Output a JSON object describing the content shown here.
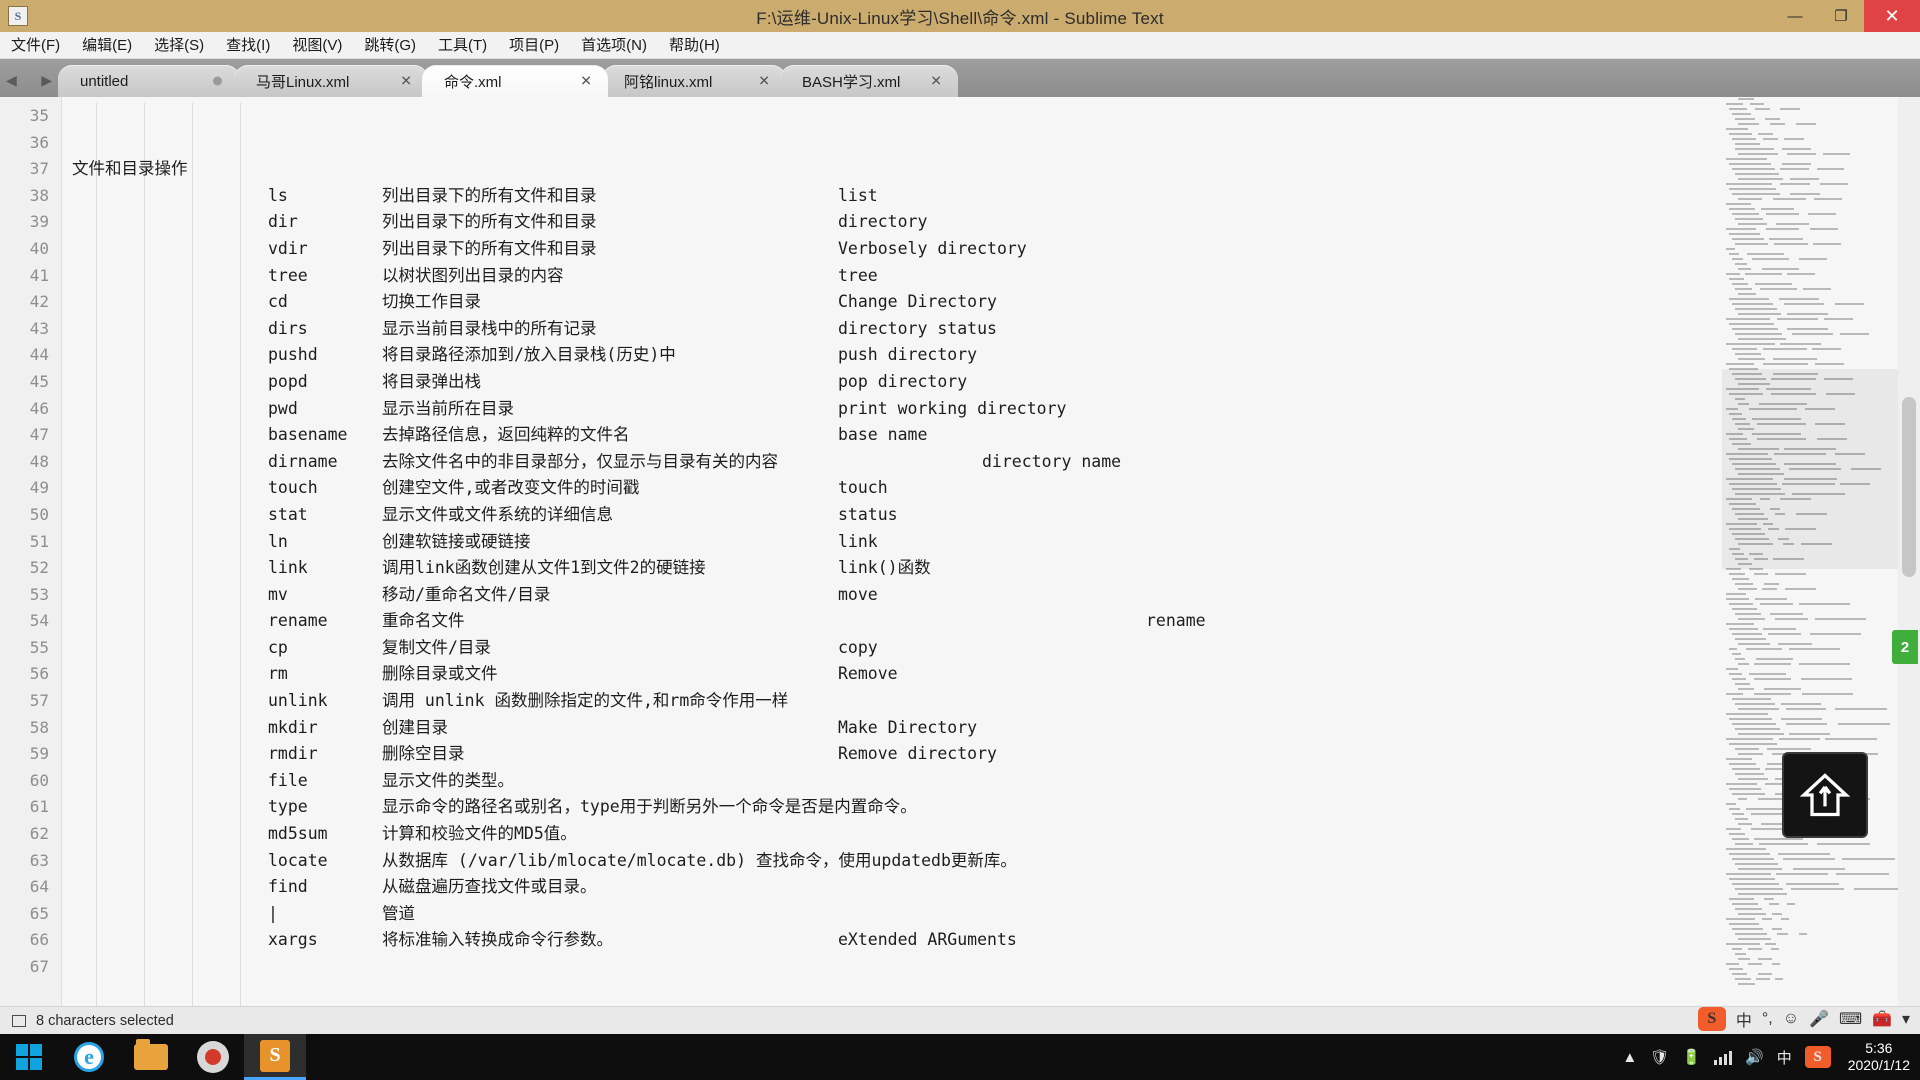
{
  "window": {
    "title": "F:\\运维-Unix-Linux学习\\Shell\\命令.xml - Sublime Text",
    "app_icon": "sublime-icon",
    "minimize": "—",
    "maximize": "❐",
    "close": "✕"
  },
  "menubar": {
    "items": [
      {
        "label": "文件(F)"
      },
      {
        "label": "编辑(E)"
      },
      {
        "label": "选择(S)"
      },
      {
        "label": "查找(I)"
      },
      {
        "label": "视图(V)"
      },
      {
        "label": "跳转(G)"
      },
      {
        "label": "工具(T)"
      },
      {
        "label": "项目(P)"
      },
      {
        "label": "首选项(N)"
      },
      {
        "label": "帮助(H)"
      }
    ]
  },
  "tabbar": {
    "prev_arrow": "◀",
    "next_arrow": "▶",
    "tabs": [
      {
        "label": "untitled",
        "active": false,
        "dirty": true,
        "close": ""
      },
      {
        "label": "马哥Linux.xml",
        "active": false,
        "dirty": false,
        "close": "✕"
      },
      {
        "label": "命令.xml",
        "active": true,
        "dirty": false,
        "close": "✕"
      },
      {
        "label": "阿铭linux.xml",
        "active": false,
        "dirty": false,
        "close": "✕"
      },
      {
        "label": "BASH学习.xml",
        "active": false,
        "dirty": false,
        "close": "✕"
      }
    ]
  },
  "editor": {
    "first_line_number": 35,
    "lines": [
      {
        "n": "35",
        "cmd": "",
        "desc": "",
        "en": "",
        "heading": ""
      },
      {
        "n": "36",
        "cmd": "",
        "desc": "",
        "en": "",
        "heading": ""
      },
      {
        "n": "37",
        "cmd": "",
        "desc": "",
        "en": "",
        "heading": "文件和目录操作"
      },
      {
        "n": "38",
        "cmd": "ls",
        "desc": "列出目录下的所有文件和目录",
        "en": "list",
        "heading": ""
      },
      {
        "n": "39",
        "cmd": "dir",
        "desc": "列出目录下的所有文件和目录",
        "en": "directory",
        "heading": ""
      },
      {
        "n": "40",
        "cmd": "vdir",
        "desc": "列出目录下的所有文件和目录",
        "en": "Verbosely directory",
        "heading": ""
      },
      {
        "n": "41",
        "cmd": "tree",
        "desc": "以树状图列出目录的内容",
        "en": "tree",
        "heading": ""
      },
      {
        "n": "42",
        "cmd": "cd",
        "desc": "切换工作目录",
        "en": "Change Directory",
        "heading": ""
      },
      {
        "n": "43",
        "cmd": "dirs",
        "desc": "显示当前目录栈中的所有记录",
        "en": "directory status",
        "heading": ""
      },
      {
        "n": "44",
        "cmd": "pushd",
        "desc": "将目录路径添加到/放入目录栈(历史)中",
        "en": "push directory",
        "heading": ""
      },
      {
        "n": "45",
        "cmd": "popd",
        "desc": "将目录弹出栈",
        "en": "pop directory",
        "heading": ""
      },
      {
        "n": "46",
        "cmd": "pwd",
        "desc": "显示当前所在目录",
        "en": "print working directory",
        "heading": ""
      },
      {
        "n": "47",
        "cmd": "basename",
        "desc": "去掉路径信息，返回纯粹的文件名",
        "en": "base name",
        "heading": ""
      },
      {
        "n": "48",
        "cmd": "dirname",
        "desc": "去除文件名中的非目录部分，仅显示与目录有关的内容",
        "en": "directory name",
        "heading": "",
        "wide": true
      },
      {
        "n": "49",
        "cmd": "touch",
        "desc": "创建空文件,或者改变文件的时间戳",
        "en": "touch",
        "heading": ""
      },
      {
        "n": "50",
        "cmd": "stat",
        "desc": "显示文件或文件系统的详细信息",
        "en": "status",
        "heading": ""
      },
      {
        "n": "51",
        "cmd": "ln",
        "desc": "创建软链接或硬链接",
        "en": "link",
        "heading": ""
      },
      {
        "n": "52",
        "cmd": "link",
        "desc": "调用link函数创建从文件1到文件2的硬链接",
        "en": "link()函数",
        "heading": ""
      },
      {
        "n": "53",
        "cmd": "mv",
        "desc": "移动/重命名文件/目录",
        "en": "move",
        "heading": ""
      },
      {
        "n": "54",
        "cmd": "rename",
        "desc": "重命名文件",
        "en": "rename",
        "heading": "",
        "en_indent": 28
      },
      {
        "n": "55",
        "cmd": "cp",
        "desc": "复制文件/目录",
        "en": "copy",
        "heading": ""
      },
      {
        "n": "56",
        "cmd": "rm",
        "desc": "删除目录或文件",
        "en": "Remove",
        "heading": ""
      },
      {
        "n": "57",
        "cmd": "unlink",
        "desc": "调用 unlink 函数删除指定的文件,和rm命令作用一样",
        "en": "",
        "heading": ""
      },
      {
        "n": "58",
        "cmd": "mkdir",
        "desc": "创建目录",
        "en": "Make Directory",
        "heading": ""
      },
      {
        "n": "59",
        "cmd": "rmdir",
        "desc": "删除空目录",
        "en": "Remove directory",
        "heading": ""
      },
      {
        "n": "60",
        "cmd": "file",
        "desc": "显示文件的类型。",
        "en": "",
        "heading": ""
      },
      {
        "n": "61",
        "cmd": "type",
        "desc": "显示命令的路径名或别名，type用于判断另外一个命令是否是内置命令。",
        "en": "",
        "heading": ""
      },
      {
        "n": "62",
        "cmd": "md5sum",
        "desc": "计算和校验文件的MD5值。",
        "en": "",
        "heading": ""
      },
      {
        "n": "63",
        "cmd": "locate",
        "desc": "从数据库 (/var/lib/mlocate/mlocate.db) 查找命令，使用updatedb更新库。",
        "en": "",
        "heading": ""
      },
      {
        "n": "64",
        "cmd": "find",
        "desc": "从磁盘遍历查找文件或目录。",
        "en": "",
        "heading": ""
      },
      {
        "n": "65",
        "cmd": "|",
        "desc": "管道",
        "en": "",
        "heading": ""
      },
      {
        "n": "66",
        "cmd": "xargs",
        "desc": "将标准输入转换成命令行参数。",
        "en": "eXtended ARGuments",
        "heading": ""
      },
      {
        "n": "67",
        "cmd": "",
        "desc": "",
        "en": "",
        "heading": ""
      }
    ]
  },
  "statusbar": {
    "selection_text": "8 characters selected",
    "icon": "panel-icon"
  },
  "tray": {
    "sogou_logo": "S",
    "chinese_mode": "中",
    "punct": "°,",
    "emoji": "☺",
    "mic": "🎤",
    "keyboard": "⌨",
    "toolbox": "🧰",
    "more": "▾"
  },
  "taskbar": {
    "start": "windows-logo",
    "items": [
      {
        "name": "internet-explorer",
        "glyph": "e",
        "active": false
      },
      {
        "name": "file-explorer",
        "glyph": "",
        "active": false
      },
      {
        "name": "screen-recorder",
        "glyph": "",
        "active": false
      },
      {
        "name": "sublime-text",
        "glyph": "S",
        "active": true
      }
    ],
    "tray": {
      "expand": "▲",
      "shield": "🛡",
      "battery": "🔋",
      "signal": "signal-icon",
      "volume": "🔊",
      "ime": "中",
      "sogou": "S"
    },
    "clock": {
      "time": "5:36",
      "date": "2020/1/12"
    }
  },
  "colors": {
    "titlebar": "#ccab6e",
    "close_button": "#e04343",
    "tabbar": "#919191",
    "editor_bg": "#f6f6f6",
    "accent_green": "#3fae3a",
    "taskbar": "#0e0e0e"
  }
}
